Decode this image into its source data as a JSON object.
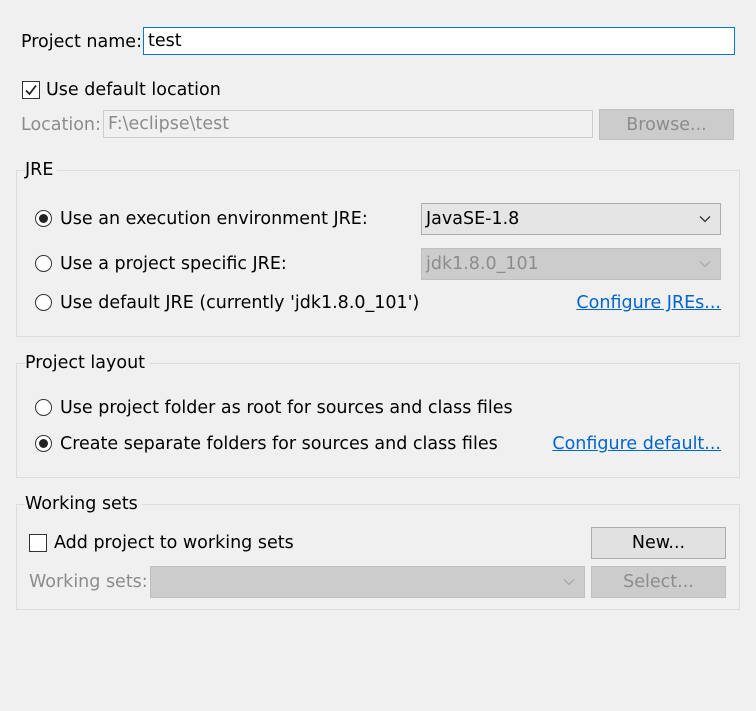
{
  "project_name": {
    "label": "Project name:",
    "value": "test"
  },
  "location": {
    "use_default_label": "Use default location",
    "use_default_checked": true,
    "label": "Location:",
    "value": "F:\\eclipse\\test",
    "browse_label": "Browse..."
  },
  "jre": {
    "title": "JRE",
    "options": [
      {
        "label": "Use an execution environment JRE:",
        "checked": true
      },
      {
        "label": "Use a project specific JRE:",
        "checked": false
      },
      {
        "label": "Use default JRE (currently 'jdk1.8.0_101')",
        "checked": false
      }
    ],
    "execution_env_value": "JavaSE-1.8",
    "project_specific_value": "jdk1.8.0_101",
    "configure_link": "Configure JREs..."
  },
  "project_layout": {
    "title": "Project layout",
    "options": [
      {
        "label": "Use project folder as root for sources and class files",
        "checked": false
      },
      {
        "label": "Create separate folders for sources and class files",
        "checked": true
      }
    ],
    "configure_link": "Configure default..."
  },
  "working_sets": {
    "title": "Working sets",
    "add_label": "Add project to working sets",
    "add_checked": false,
    "new_label": "New...",
    "sets_label": "Working sets:",
    "sets_value": "",
    "select_label": "Select..."
  },
  "colors": {
    "focus_border": "#0078d7",
    "link": "#0066cc",
    "background": "#f0f0f0"
  }
}
